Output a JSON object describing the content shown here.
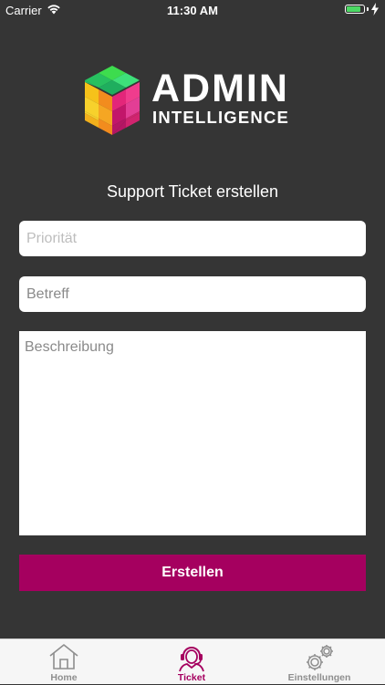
{
  "status_bar": {
    "carrier": "Carrier",
    "time": "11:30 AM",
    "battery_level": 0.85
  },
  "logo": {
    "line1": "ADMIN",
    "line2": "INTELLIGENCE"
  },
  "form": {
    "title": "Support Ticket erstellen",
    "priority_placeholder": "Priorität",
    "priority_value": "",
    "subject_placeholder": "Betreff",
    "subject_value": "",
    "description_placeholder": "Beschreibung",
    "description_value": "",
    "submit_label": "Erstellen"
  },
  "tab_bar": {
    "active": "ticket",
    "items": [
      {
        "id": "home",
        "label": "Home",
        "icon": "home-icon"
      },
      {
        "id": "ticket",
        "label": "Ticket",
        "icon": "support-agent-icon"
      },
      {
        "id": "settings",
        "label": "Einstellungen",
        "icon": "gears-icon"
      }
    ]
  },
  "colors": {
    "background": "#353535",
    "accent": "#a5005f",
    "tab_inactive": "#8e8e8e",
    "battery": "#4cd964"
  }
}
